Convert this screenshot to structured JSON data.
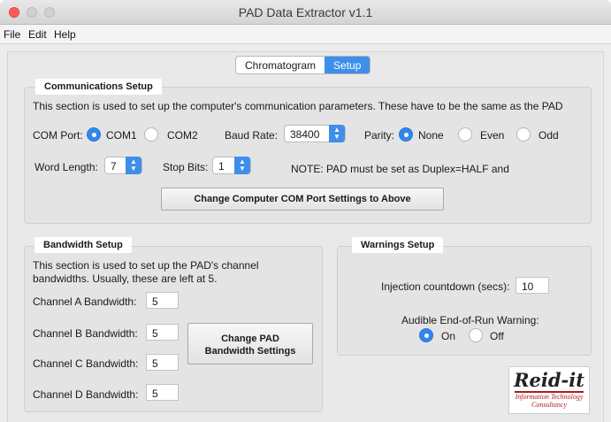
{
  "window": {
    "title": "PAD Data Extractor v1.1"
  },
  "menu": [
    "File",
    "Edit",
    "Help"
  ],
  "tabs": [
    {
      "label": "Chromatogram",
      "active": false
    },
    {
      "label": "Setup",
      "active": true
    }
  ],
  "comms": {
    "legend": "Communications Setup",
    "description": "This section is used to set up the computer's communication parameters.  These have to be the same as the PAD",
    "com_port_label": "COM Port:",
    "com_options": [
      {
        "label": "COM1",
        "selected": true
      },
      {
        "label": "COM2",
        "selected": false
      }
    ],
    "baud_label": "Baud Rate:",
    "baud_value": "38400",
    "parity_label": "Parity:",
    "parity_options": [
      {
        "label": "None",
        "selected": true
      },
      {
        "label": "Even",
        "selected": false
      },
      {
        "label": "Odd",
        "selected": false
      }
    ],
    "word_length_label": "Word Length:",
    "word_length_value": "7",
    "stop_bits_label": "Stop Bits:",
    "stop_bits_value": "1",
    "note": "NOTE: PAD must be set as Duplex=HALF and",
    "apply_button": "Change Computer COM Port Settings to Above"
  },
  "bandwidth": {
    "legend": "Bandwidth Setup",
    "description_line1": "This section is used to set up the PAD's channel",
    "description_line2": "bandwidths.  Usually, these are left at 5.",
    "channels": [
      {
        "label": "Channel A Bandwidth:",
        "value": "5"
      },
      {
        "label": "Channel B Bandwidth:",
        "value": "5"
      },
      {
        "label": "Channel C Bandwidth:",
        "value": "5"
      },
      {
        "label": "Channel D Bandwidth:",
        "value": "5"
      }
    ],
    "button_line1": "Change PAD",
    "button_line2": "Bandwidth Settings"
  },
  "warnings": {
    "legend": "Warnings Setup",
    "countdown_label": "Injection countdown (secs):",
    "countdown_value": "10",
    "audible_label": "Audible End-of-Run Warning:",
    "options": [
      {
        "label": "On",
        "selected": true
      },
      {
        "label": "Off",
        "selected": false
      }
    ]
  },
  "logo": {
    "name": "Reid-it",
    "tagline1": "Information Technology",
    "tagline2": "Consultancy"
  },
  "colors": {
    "accent": "#3d8fea",
    "close": "#fc5e56",
    "logo_red": "#b31c1c"
  }
}
